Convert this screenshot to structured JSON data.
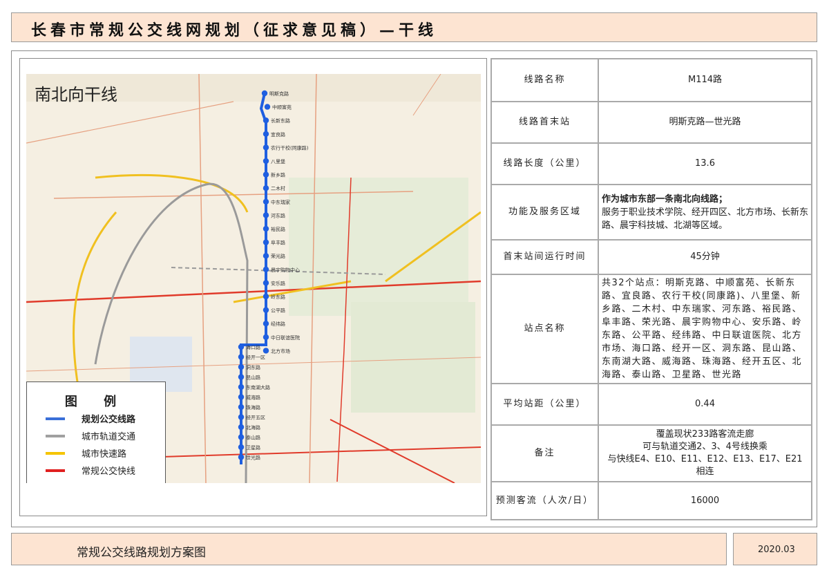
{
  "header": {
    "title": "长春市常规公交线网规划（征求意见稿）—干线"
  },
  "map": {
    "title": "南北向干线",
    "legend": {
      "title": "图 例",
      "items": [
        {
          "label": "规划公交线路",
          "color": "#3a6fd8"
        },
        {
          "label": "城市轨道交通",
          "color": "#a0a0a0"
        },
        {
          "label": "城市快速路",
          "color": "#f5c400"
        },
        {
          "label": "常规公交快线",
          "color": "#e02020"
        }
      ]
    },
    "route_color": "#1f5fe0"
  },
  "table": [
    {
      "key": "线路名称",
      "value": "M114路"
    },
    {
      "key": "线路首末站",
      "value": "明斯克路—世光路"
    },
    {
      "key": "线路长度（公里）",
      "value": "13.6"
    },
    {
      "key": "功能及服务区域",
      "value_bold": "作为城市东部一条南北向线路；",
      "value": "服务于职业技术学院、经开四区、北方市场、长新东路、晨宇科技城、北湖等区域。"
    },
    {
      "key": "首末站间运行时间",
      "value": "45分钟"
    },
    {
      "key": "站点名称",
      "value": "共32个站点：明斯克路、中顺富苑、长新东路、宜良路、农行干校(同康路)、八里堡、新乡路、二木村、中东瑞家、河东路、裕民路、阜丰路、荣光路、晨宇购物中心、安乐路、岭东路、公平路、经纬路、中日联谊医院、北方市场、海口路、经开一区、洞东路、昆山路、东南湖大路、威海路、珠海路、经开五区、北海路、泰山路、卫星路、世光路"
    },
    {
      "key": "平均站距（公里）",
      "value": "0.44"
    },
    {
      "key": "备注",
      "lines": [
        "覆盖现状233路客流走廊",
        "可与轨道交通2、3、4号线换乘",
        "与快线E4、E10、E11、E12、E13、E17、E21",
        "相连"
      ]
    },
    {
      "key": "预测客流（人次/日）",
      "value": "16000"
    }
  ],
  "stations": [
    "明斯克路",
    "中顺富苑",
    "长新东路",
    "宜良路",
    "农行干校(同康路)",
    "八里堡",
    "新乡路",
    "二木村",
    "中东瑞家",
    "河东路",
    "裕民路",
    "阜丰路",
    "荣光路",
    "晨宇购物中心",
    "安乐路",
    "岭东路",
    "公平路",
    "经纬路",
    "中日联谊医院",
    "北方市场",
    "海口路",
    "经开一区",
    "洞东路",
    "昆山路",
    "东南湖大路",
    "威海路",
    "珠海路",
    "经开五区",
    "北海路",
    "泰山路",
    "卫星路",
    "世光路"
  ],
  "footer": {
    "caption": "常规公交线路规划方案图",
    "date": "2020.03"
  }
}
